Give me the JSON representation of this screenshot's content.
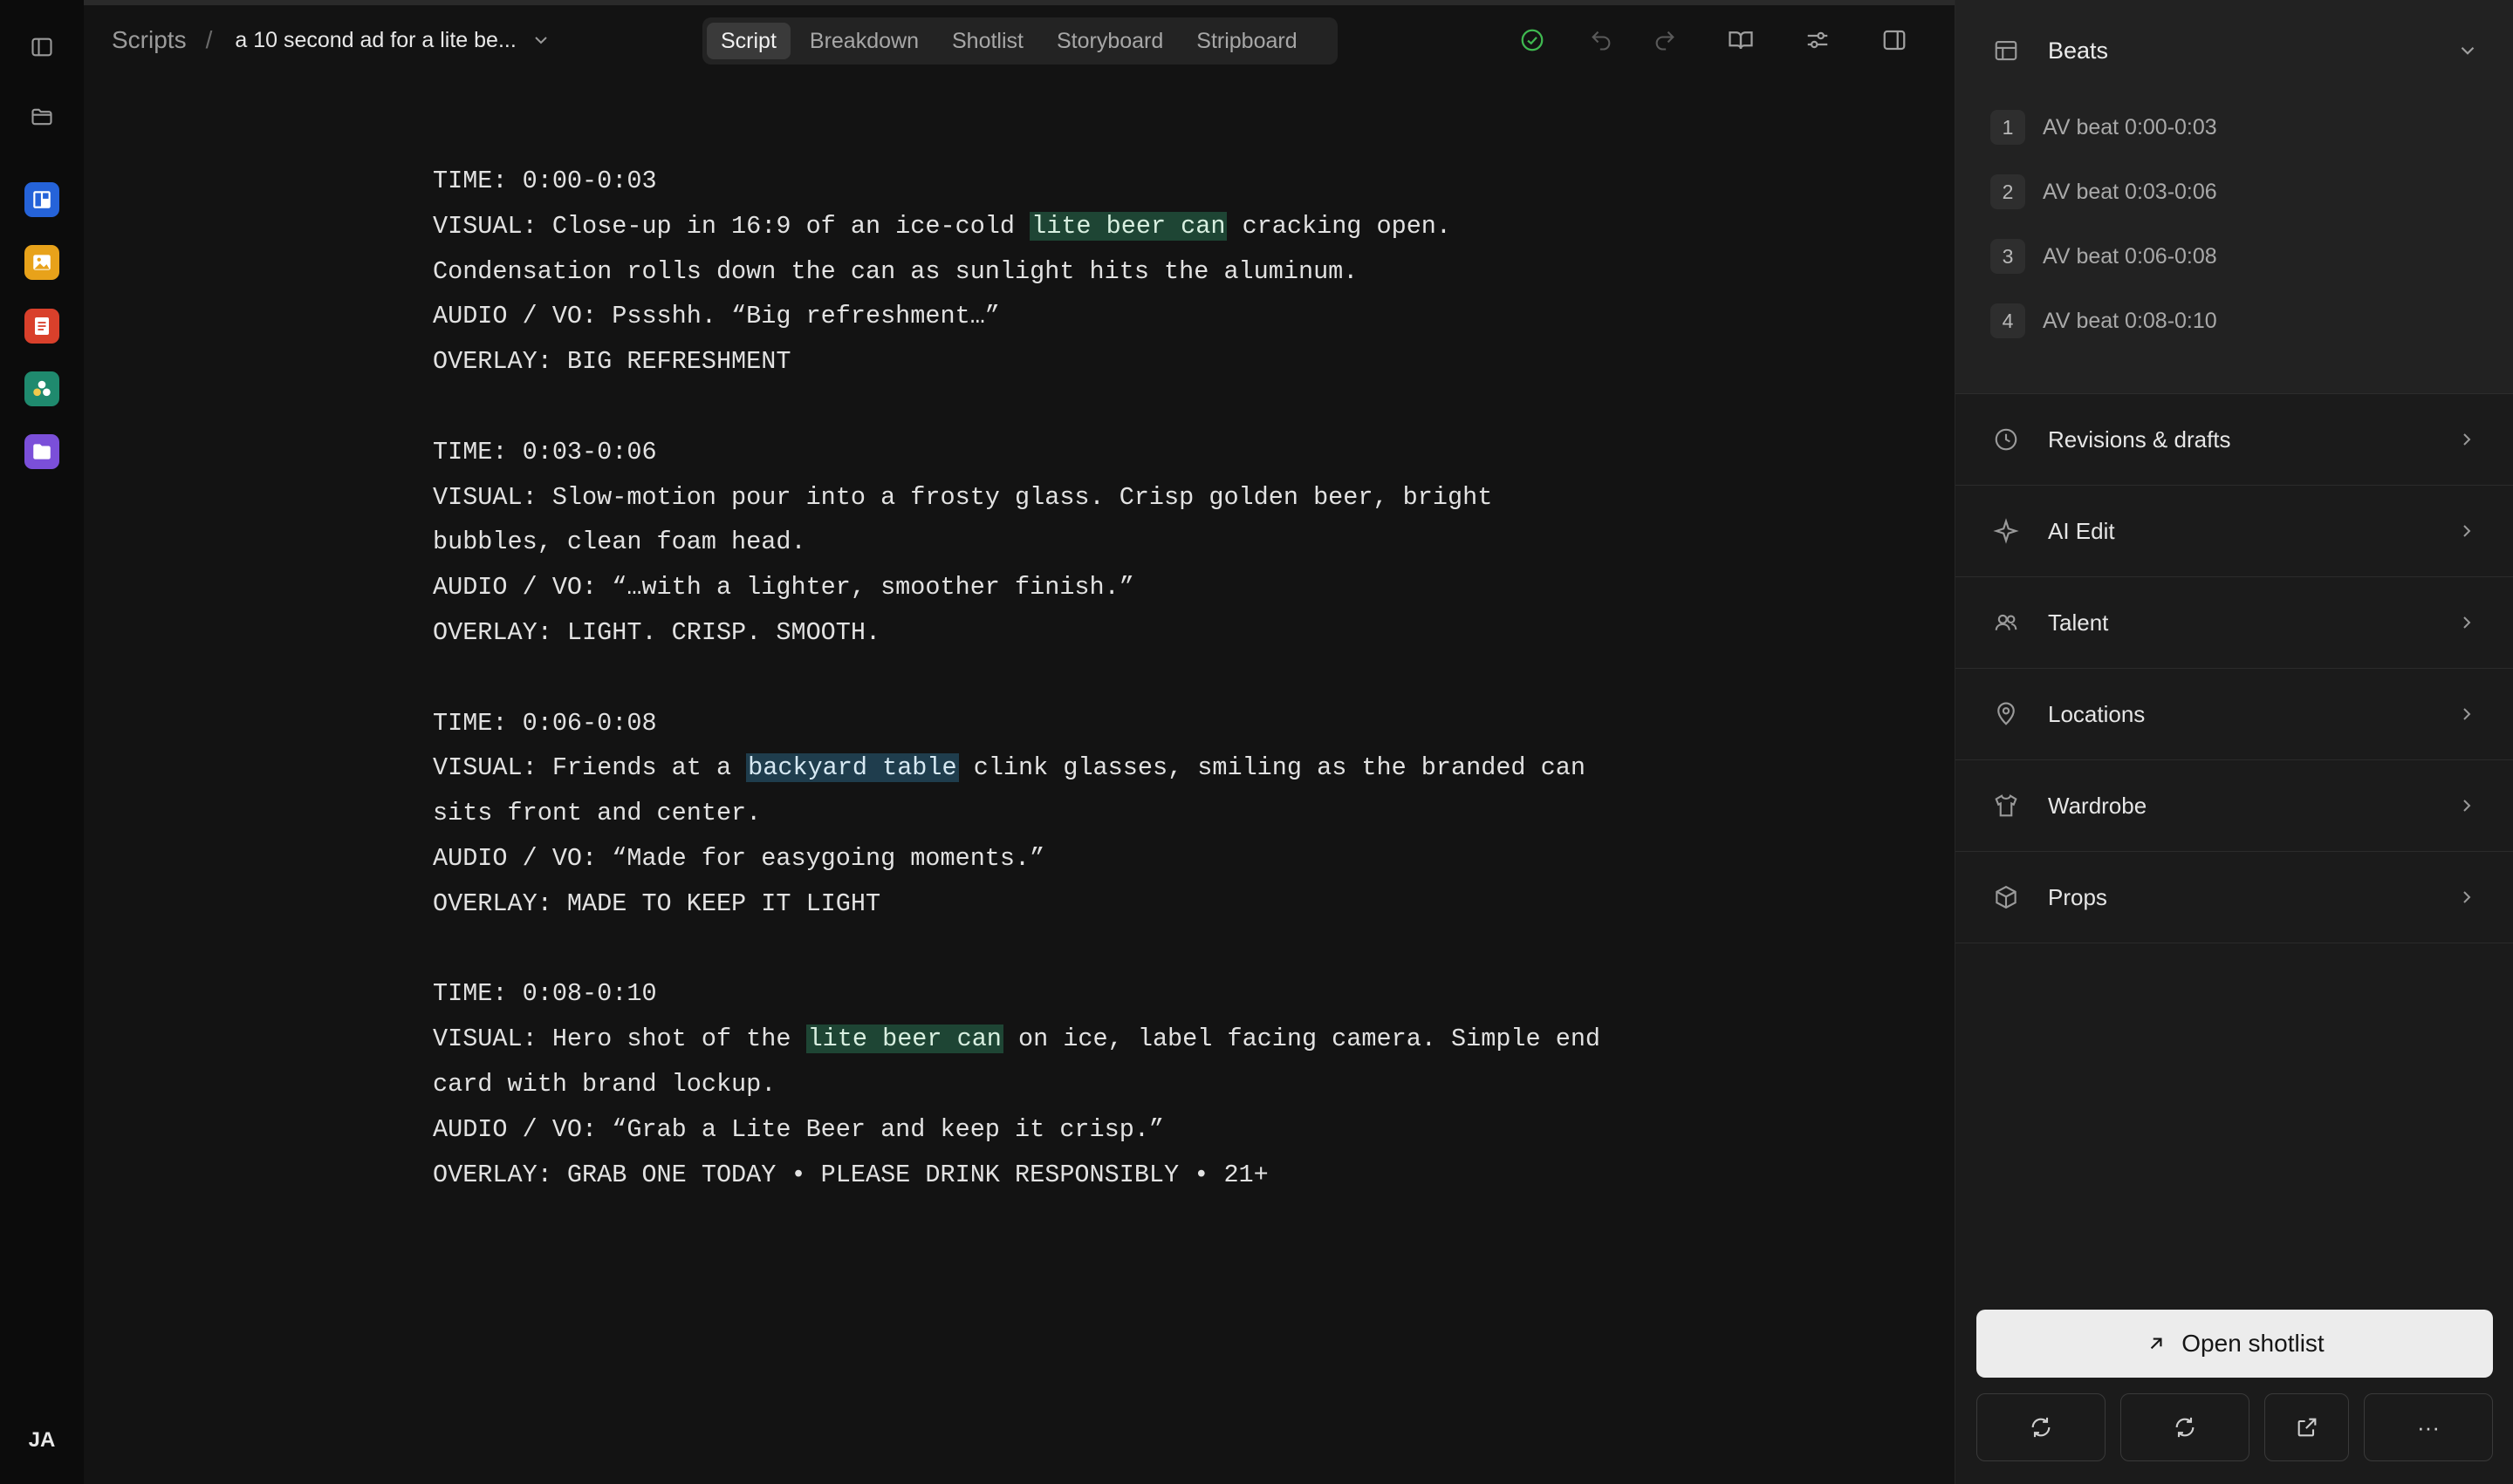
{
  "rail": {
    "avatar_initials": "JA",
    "apps": [
      {
        "name": "board-app-icon",
        "color": "#2563d9"
      },
      {
        "name": "image-app-icon",
        "color": "#e8a21a"
      },
      {
        "name": "document-app-icon",
        "color": "#d9402b"
      },
      {
        "name": "cast-app-icon",
        "color": "#1f8a6e"
      },
      {
        "name": "folder-app-icon",
        "color": "#7b4fd9"
      }
    ]
  },
  "header": {
    "breadcrumb_root": "Scripts",
    "breadcrumb_sep": "/",
    "document_title": "a 10 second ad for a lite be...",
    "tabs": [
      "Script",
      "Breakdown",
      "Shotlist",
      "Storyboard",
      "Stripboard"
    ],
    "active_tab": "Script"
  },
  "script": {
    "beats": [
      {
        "time": "TIME: 0:00-0:03",
        "visual_pre": "VISUAL: Close-up in 16:9 of an ice-cold ",
        "visual_hl": "lite beer can",
        "visual_post": " cracking open.",
        "visual_cont": "Condensation rolls down the can as sunlight hits the aluminum.",
        "audio": "AUDIO / VO: Pssshh. “Big refreshment…”",
        "overlay": "OVERLAY: BIG REFRESHMENT"
      },
      {
        "time": "TIME: 0:03-0:06",
        "visual_line1": "VISUAL: Slow-motion pour into a frosty glass. Crisp golden beer, bright",
        "visual_cont": "bubbles, clean foam head.",
        "audio": "AUDIO / VO: “…with a lighter, smoother finish.”",
        "overlay": "OVERLAY: LIGHT. CRISP. SMOOTH."
      },
      {
        "time": "TIME: 0:06-0:08",
        "visual_pre": "VISUAL: Friends at a ",
        "visual_hl": "backyard table",
        "visual_post": " clink glasses, smiling as the branded can",
        "visual_cont": "sits front and center.",
        "audio": "AUDIO / VO: “Made for easygoing moments.”",
        "overlay": "OVERLAY: MADE TO KEEP IT LIGHT"
      },
      {
        "time": "TIME: 0:08-0:10",
        "visual_pre": "VISUAL: Hero shot of the ",
        "visual_hl": "lite beer can",
        "visual_post": " on ice, label facing camera. Simple end",
        "visual_cont": "card with brand lockup.",
        "audio": "AUDIO / VO: “Grab a Lite Beer and keep it crisp.”",
        "overlay": "OVERLAY: GRAB ONE TODAY • PLEASE DRINK RESPONSIBLY • 21+"
      }
    ]
  },
  "panel": {
    "beats_title": "Beats",
    "beats": [
      {
        "num": "1",
        "label": "AV beat 0:00-0:03"
      },
      {
        "num": "2",
        "label": "AV beat 0:03-0:06"
      },
      {
        "num": "3",
        "label": "AV beat 0:06-0:08"
      },
      {
        "num": "4",
        "label": "AV beat 0:08-0:10"
      }
    ],
    "sections": [
      {
        "label": "Revisions & drafts",
        "icon": "clock-icon"
      },
      {
        "label": "AI Edit",
        "icon": "sparkle-icon"
      },
      {
        "label": "Talent",
        "icon": "people-icon"
      },
      {
        "label": "Locations",
        "icon": "location-pin-icon"
      },
      {
        "label": "Wardrobe",
        "icon": "shirt-icon"
      },
      {
        "label": "Props",
        "icon": "box-icon"
      }
    ],
    "open_button": "Open shotlist",
    "more_label": "···"
  },
  "colors": {
    "highlight_green": "#1e4534",
    "highlight_blue": "#1f3d4d",
    "status_ok": "#3fb950"
  }
}
